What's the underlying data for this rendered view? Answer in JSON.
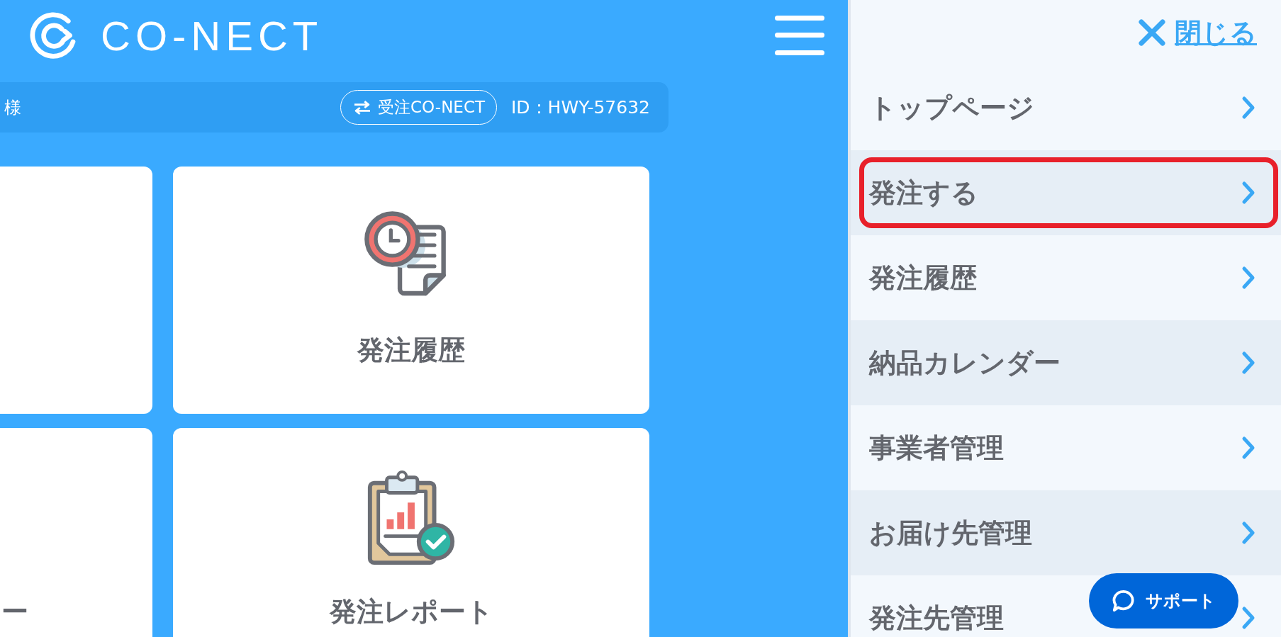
{
  "header": {
    "logo_text": "CO-NECT"
  },
  "account_bar": {
    "name_suffix": "様",
    "switch_button": "受注CO-NECT",
    "id_text": "ID：HWY-57632"
  },
  "cards": [
    {
      "kind": "cut"
    },
    {
      "kind": "history",
      "label": "発注履歴"
    },
    {
      "kind": "cut",
      "label": "ー"
    },
    {
      "kind": "report",
      "label": "発注レポート"
    }
  ],
  "menu": {
    "close_label": "閉じる",
    "items": [
      {
        "label": "トップページ",
        "highlighted": false
      },
      {
        "label": "発注する",
        "highlighted": true
      },
      {
        "label": "発注履歴",
        "highlighted": false
      },
      {
        "label": "納品カレンダー",
        "highlighted": false
      },
      {
        "label": "事業者管理",
        "highlighted": false
      },
      {
        "label": "お届け先管理",
        "highlighted": false
      },
      {
        "label": "発注先管理",
        "highlighted": false
      }
    ]
  },
  "support_button": "サポート"
}
